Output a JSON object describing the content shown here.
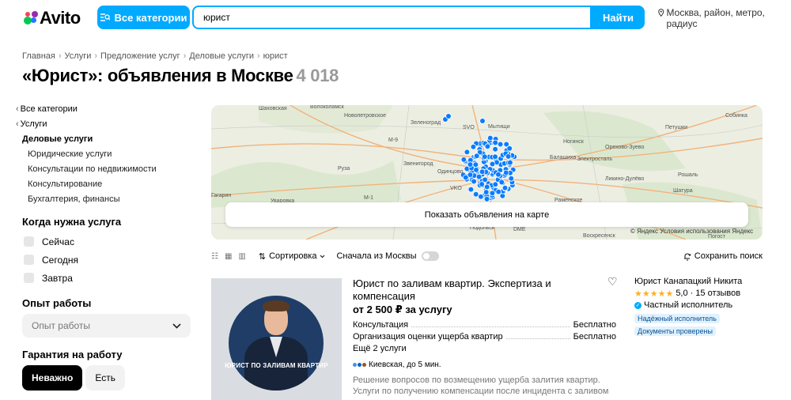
{
  "header": {
    "logo_text": "Avito",
    "categories_label": "Все категории",
    "search_value": "юрист",
    "find_label": "Найти",
    "location_text": "Москва, район, метро, радиус"
  },
  "breadcrumb": [
    "Главная",
    "Услуги",
    "Предложение услуг",
    "Деловые услуги",
    "юрист"
  ],
  "title": {
    "text": "«Юрист»: объявления в Москве",
    "count": "4 018"
  },
  "sidebar": {
    "all_categories": "Все категории",
    "services": "Услуги",
    "business_services": "Деловые услуги",
    "subcategories": [
      "Юридические услуги",
      "Консультации по недвижимости",
      "Консультирование",
      "Бухгалтерия, финансы"
    ],
    "when_heading": "Когда нужна услуга",
    "when_options": [
      "Сейчас",
      "Сегодня",
      "Завтра"
    ],
    "experience_heading": "Опыт работы",
    "experience_placeholder": "Опыт работы",
    "guarantee_heading": "Гарантия на работу",
    "guarantee_options": [
      "Неважно",
      "Есть"
    ]
  },
  "map": {
    "show_button": "Показать объявления на карте",
    "copyright": "© Яндекс Условия использования Яндекс",
    "labels": [
      "Шаховская",
      "Волоколамск",
      "Новопетровское",
      "Зеленоград",
      "SVO",
      "Мытищи",
      "Ногинск",
      "Петушки",
      "Собинка",
      "Руза",
      "Звенигород",
      "Одинцово",
      "Балашиха",
      "Электросталь",
      "Орехово-Зуево",
      "Ликино-Дулёво",
      "Рошаль",
      "Гагарин",
      "Уваровка",
      "VKO",
      "Раменское",
      "Шатура",
      "Подольск",
      "DME",
      "Воскресенск",
      "Погост",
      "М-9",
      "М-1"
    ]
  },
  "toolbar": {
    "sort_label": "Сортировка",
    "moscow_first_label": "Сначала из Москвы",
    "save_search_label": "Сохранить поиск"
  },
  "listing": {
    "image_caption": "ЮРИСТ ПО ЗАЛИВАМ КВАРТИР",
    "title": "Юрист по заливам квартир. Экспертиза и компенсация",
    "price": "от 2 500 ₽ за услугу",
    "services": [
      {
        "name": "Консультация",
        "price": "Бесплатно"
      },
      {
        "name": "Организация оценки ущерба квартир",
        "price": "Бесплатно"
      }
    ],
    "more_services": "Ещё 2 услуги",
    "metro": "Киевская, до 5 мин.",
    "description": "Решение вопросов по возмещению ущерба залития квартир. Услуги по получению компенсации после инцидента с заливом"
  },
  "seller": {
    "name": "Юрист Канапацкий Никита",
    "rating": "5,0",
    "reviews": "15 отзывов",
    "type": "Частный исполнитель",
    "badges": [
      "Надёжный исполнитель",
      "Документы проверены"
    ]
  },
  "colors": {
    "accent": "#00aaff",
    "rating_star": "#ffb021",
    "map_marker": "#0a7cff"
  }
}
